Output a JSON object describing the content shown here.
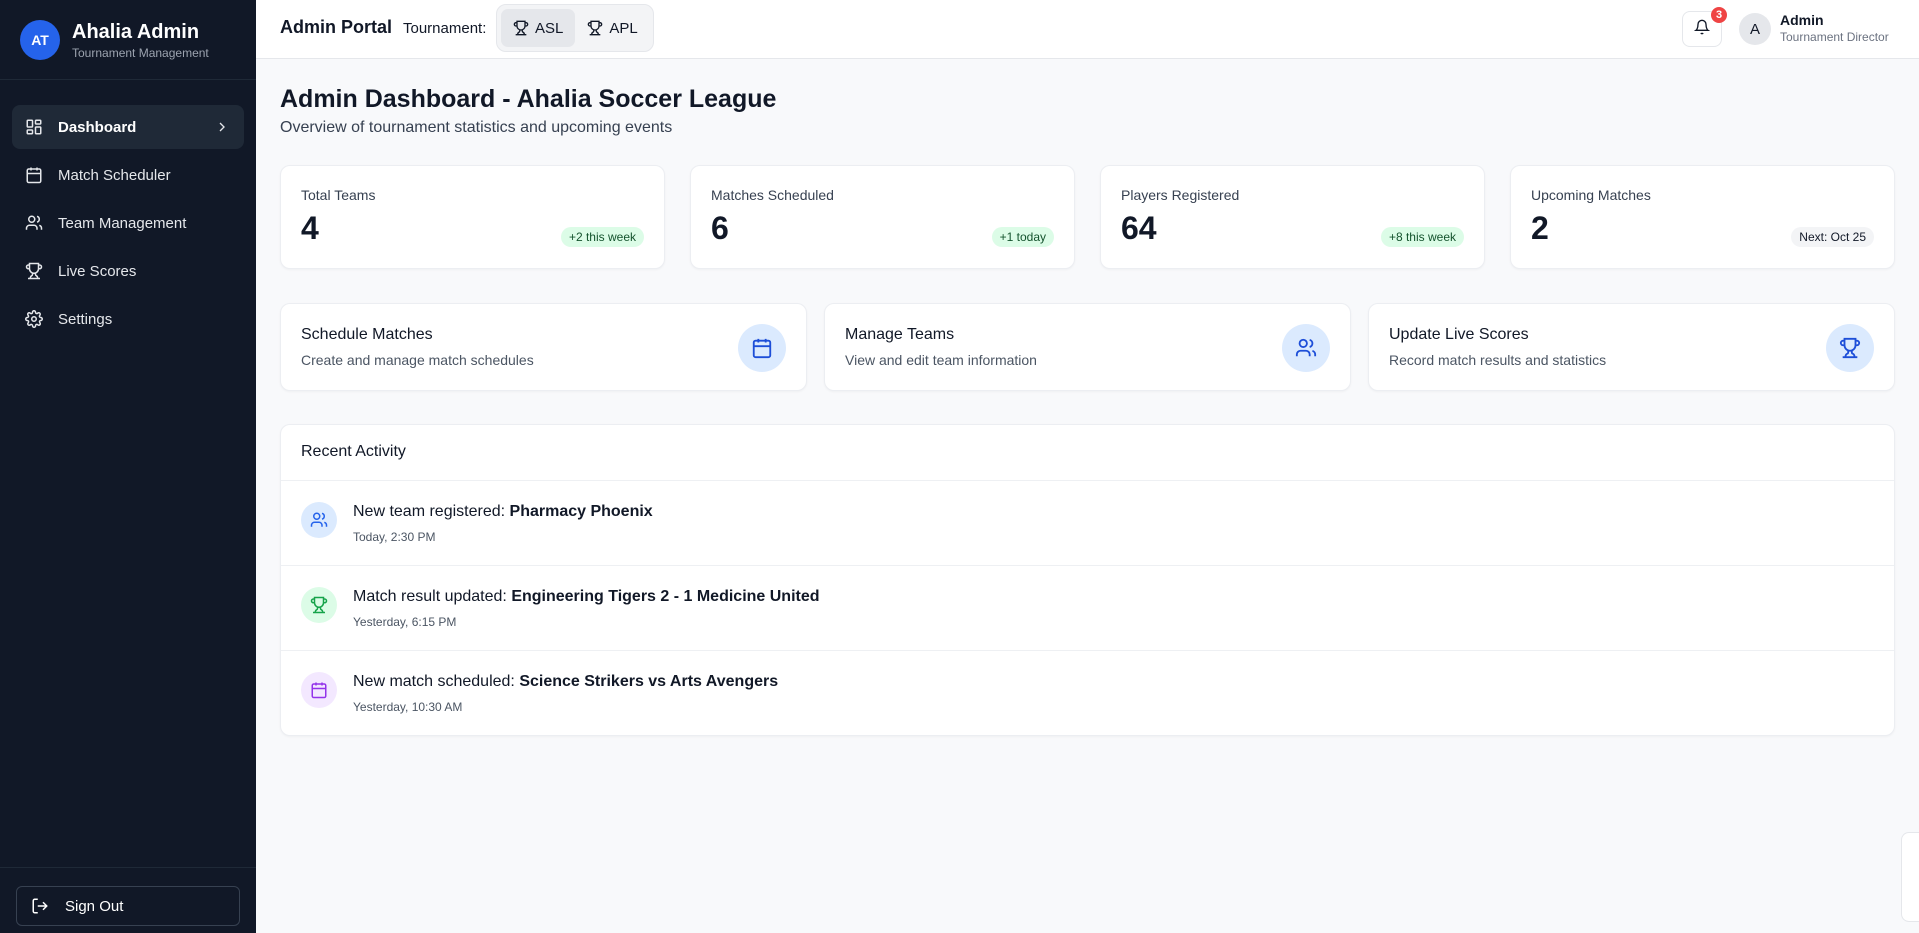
{
  "sidebar": {
    "avatar_initials": "AT",
    "title": "Ahalia Admin",
    "subtitle": "Tournament Management",
    "items": [
      {
        "label": "Dashboard",
        "icon": "dashboard-grid-icon"
      },
      {
        "label": "Match Scheduler",
        "icon": "calendar-icon"
      },
      {
        "label": "Team Management",
        "icon": "users-icon"
      },
      {
        "label": "Live Scores",
        "icon": "trophy-icon"
      },
      {
        "label": "Settings",
        "icon": "gear-icon"
      }
    ],
    "sign_out": "Sign Out"
  },
  "header": {
    "title": "Admin Portal",
    "tournament_label": "Tournament:",
    "tournaments": [
      {
        "label": "ASL",
        "active": true
      },
      {
        "label": "APL",
        "active": false
      }
    ],
    "notification_count": "3",
    "user_initial": "A",
    "user_name": "Admin",
    "user_role": "Tournament Director"
  },
  "page": {
    "title": "Admin Dashboard - Ahalia Soccer League",
    "subtitle": "Overview of tournament statistics and upcoming events"
  },
  "stats": [
    {
      "label": "Total Teams",
      "value": "4",
      "badge": "+2 this week",
      "tone": "green"
    },
    {
      "label": "Matches Scheduled",
      "value": "6",
      "badge": "+1 today",
      "tone": "green"
    },
    {
      "label": "Players Registered",
      "value": "64",
      "badge": "+8 this week",
      "tone": "green"
    },
    {
      "label": "Upcoming Matches",
      "value": "2",
      "badge": "Next: Oct 25",
      "tone": "gray"
    }
  ],
  "actions": [
    {
      "title": "Schedule Matches",
      "desc": "Create and manage match schedules",
      "icon": "calendar-icon"
    },
    {
      "title": "Manage Teams",
      "desc": "View and edit team information",
      "icon": "users-icon"
    },
    {
      "title": "Update Live Scores",
      "desc": "Record match results and statistics",
      "icon": "trophy-icon"
    }
  ],
  "activity": {
    "title": "Recent Activity",
    "items": [
      {
        "prefix": "New team registered: ",
        "bold": "Pharmacy Phoenix",
        "time": "Today, 2:30 PM",
        "icon": "users-icon",
        "color": "#2563eb"
      },
      {
        "prefix": "Match result updated: ",
        "bold": "Engineering Tigers 2 - 1 Medicine United",
        "time": "Yesterday, 6:15 PM",
        "icon": "trophy-icon",
        "color": "#16a34a"
      },
      {
        "prefix": "New match scheduled: ",
        "bold": "Science Strikers vs Arts Avengers",
        "time": "Yesterday, 10:30 AM",
        "icon": "calendar-icon",
        "color": "#9333ea"
      }
    ]
  },
  "colors": {
    "sidebar_bg": "#111827",
    "accent": "#2563eb",
    "badge_red": "#ef4444",
    "positive_bg": "#dcfce7"
  }
}
